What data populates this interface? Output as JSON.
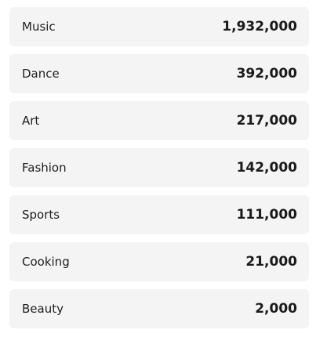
{
  "items": [
    {
      "label": "Music",
      "value": "1,932,000"
    },
    {
      "label": "Dance",
      "value": "392,000"
    },
    {
      "label": "Art",
      "value": "217,000"
    },
    {
      "label": "Fashion",
      "value": "142,000"
    },
    {
      "label": "Sports",
      "value": "111,000"
    },
    {
      "label": "Cooking",
      "value": "21,000"
    },
    {
      "label": "Beauty",
      "value": "2,000"
    }
  ]
}
